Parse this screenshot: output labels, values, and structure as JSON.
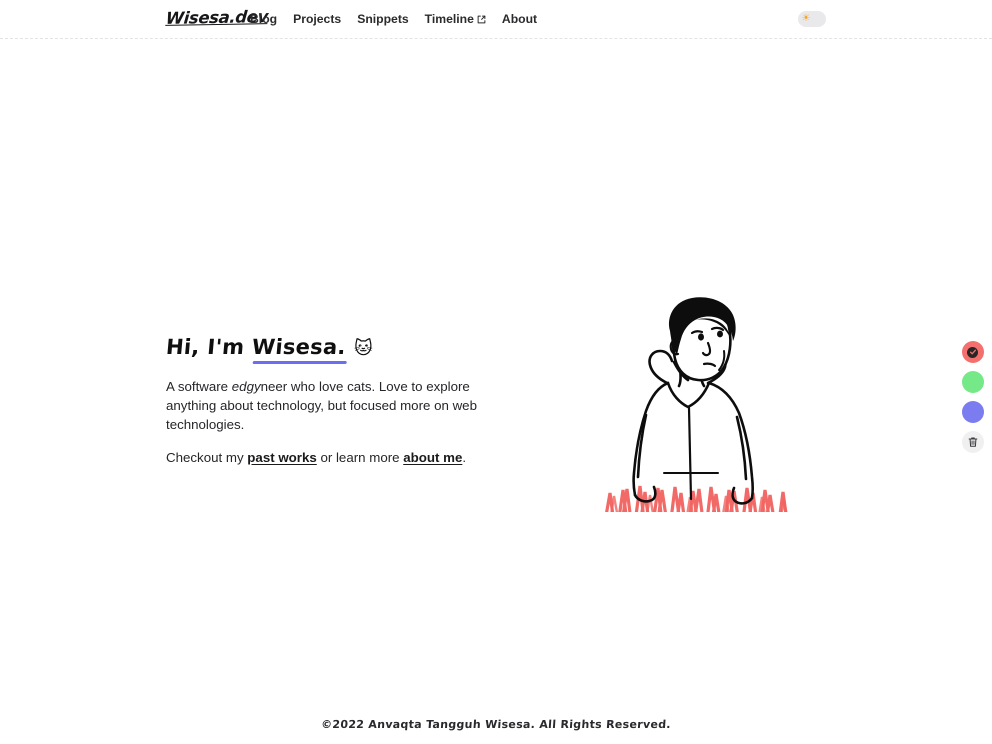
{
  "site": {
    "logo": "Wisesa.dev",
    "accent_underline_color": "#6b6ef0"
  },
  "header": {
    "nav_items": [
      {
        "label": "Blog",
        "external": false
      },
      {
        "label": "Projects",
        "external": false
      },
      {
        "label": "Snippets",
        "external": false
      },
      {
        "label": "Timeline",
        "external": true
      },
      {
        "label": "About",
        "external": false
      }
    ],
    "theme_toggle": {
      "state": "light",
      "icon": "sun-icon",
      "icon_glyph": "☀",
      "icon_color": "#f5a623"
    }
  },
  "hero": {
    "greeting_prefix": "Hi, I'm ",
    "greeting_name": "Wisesa.",
    "emoji": "🐱",
    "emoji_name": "cat-face-emoji",
    "bio_part1": "A software ",
    "bio_emphasis": "edgy",
    "bio_part2": "neer who love cats. Love to explore anything about technology, but focused more on web technologies.",
    "cta_prefix": "Checkout my ",
    "cta_link1": "past works",
    "cta_middle": " or learn more ",
    "cta_link2": "about me",
    "cta_suffix": "."
  },
  "illustration": {
    "name": "person-hoodie-doodle",
    "line_color": "#0d0d0d",
    "scribble_color": "#f2635f"
  },
  "tool_dock": {
    "swatches": [
      {
        "name": "color-swatch-red",
        "color": "#f4706f",
        "selected": true
      },
      {
        "name": "color-swatch-green",
        "color": "#75e888",
        "selected": false
      },
      {
        "name": "color-swatch-purple",
        "color": "#7b7cf0",
        "selected": false
      }
    ],
    "delete_button": {
      "name": "trash-icon",
      "background": "#f0f0f1"
    }
  },
  "footer": {
    "copyright": "©2022 Anvaqta Tangguh Wisesa. All Rights Reserved."
  }
}
